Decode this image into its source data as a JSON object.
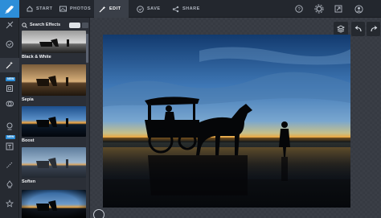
{
  "nav": {
    "tabs": [
      {
        "label": "START",
        "icon": "home-icon"
      },
      {
        "label": "PHOTOS",
        "icon": "image-icon"
      },
      {
        "label": "EDIT",
        "icon": "magic-wand-icon"
      },
      {
        "label": "SAVE",
        "icon": "save-icon"
      },
      {
        "label": "SHARE",
        "icon": "share-icon"
      }
    ],
    "active_tab": "EDIT",
    "right_icons": [
      "help-icon",
      "settings-gear-icon",
      "fullscreen-icon",
      "profile-icon"
    ]
  },
  "toolbar": {
    "tools": [
      "crop-icon",
      "adjust-icon",
      "effects-icon",
      "frame-icon",
      "overlay-icon",
      "sticker-icon",
      "text-icon",
      "draw-icon",
      "paint-icon",
      "more-icon"
    ],
    "badges": [
      "NEW",
      "NEW"
    ]
  },
  "panel": {
    "search_label": "Search Effects",
    "effects": [
      {
        "label": "Black & White"
      },
      {
        "label": "Sepia"
      },
      {
        "label": "Boost"
      },
      {
        "label": "Soften"
      },
      {
        "label": ""
      }
    ]
  },
  "canvas": {
    "tools": [
      "layers-icon",
      "undo-icon",
      "redo-icon"
    ]
  },
  "colors": {
    "accent": "#2d8ed8",
    "topbar": "#23272e",
    "panel": "#2b2f37"
  }
}
